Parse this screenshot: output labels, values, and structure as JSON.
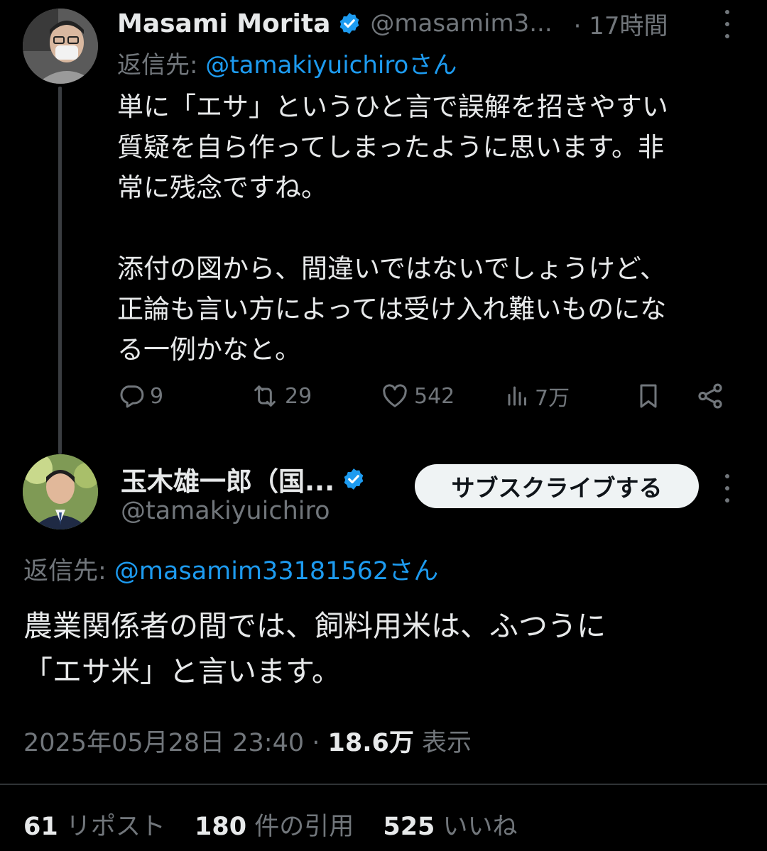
{
  "reply_tweet": {
    "display_name": "Masami Morita",
    "handle": "@masamim3...",
    "time": "· 17時間",
    "replying_prefix": "返信先: ",
    "replying_mention": "@tamakiyuichiroさん",
    "text": "単に「エサ」というひと言で誤解を招きやすい\n質疑を自ら作ってしまったように思います。非\n常に残念ですね。\n\n添付の図から、間違いではないでしょうけど、\n正論も言い方によっては受け入れ難いものにな\nる一例かなと。",
    "reply_count": "9",
    "repost_count": "29",
    "like_count": "542",
    "view_count": "7万"
  },
  "main_tweet": {
    "display_name": "玉木雄一郎（国...",
    "handle": "@tamakiyuichiro",
    "subscribe_label": "サブスクライブする",
    "replying_prefix": "返信先: ",
    "replying_mention": "@masamim33181562さん",
    "text": "農業関係者の間では、飼料用米は、ふつうに\n「エサ米」と言います。",
    "timestamp": "2025年05月28日 23:40",
    "separator": " · ",
    "views_count": "18.6万",
    "views_label": " 表示",
    "reposts_count": "61",
    "reposts_label": " リポスト",
    "quotes_count": "180",
    "quotes_label": " 件の引用",
    "likes_count": "525",
    "likes_label": " いいね"
  },
  "colors": {
    "background": "#000000",
    "text": "#e7e9ea",
    "secondary": "#71767b",
    "accent": "#1d9bf0",
    "divider": "#2f3336"
  },
  "icons": [
    "verified-badge-icon",
    "more-options-icon",
    "reply-icon",
    "repost-icon",
    "like-icon",
    "views-icon",
    "bookmark-icon",
    "share-icon"
  ]
}
